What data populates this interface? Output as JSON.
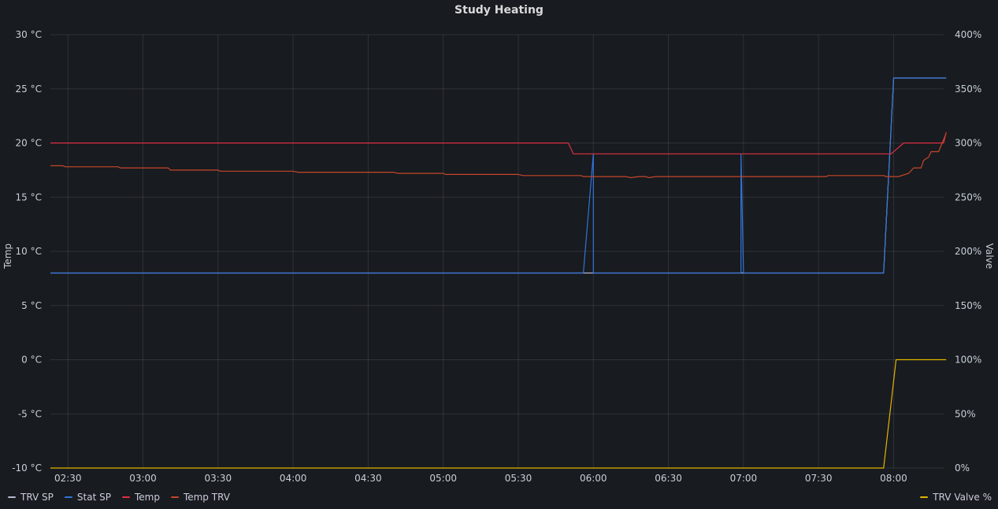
{
  "chart_data": {
    "type": "line",
    "title": "Study Heating",
    "y_left": {
      "label": "Temp",
      "ticks": [
        "30 °C",
        "25 °C",
        "20 °C",
        "15 °C",
        "10 °C",
        "5 °C",
        "0 °C",
        "-5 °C",
        "-10 °C"
      ],
      "min": -10,
      "max": 30,
      "step": 5
    },
    "y_right": {
      "label": "Valve",
      "ticks": [
        "400%",
        "350%",
        "300%",
        "250%",
        "200%",
        "150%",
        "100%",
        "50%",
        "0%"
      ],
      "min": 0,
      "max": 400,
      "step": 50
    },
    "x": {
      "ticks": [
        "02:30",
        "03:00",
        "03:30",
        "04:00",
        "04:30",
        "05:00",
        "05:30",
        "06:00",
        "06:30",
        "07:00",
        "07:30",
        "08:00"
      ],
      "start_min": 143,
      "end_min": 500
    },
    "grid": true,
    "legend": {
      "left": [
        {
          "name": "TRV SP",
          "color": "#b7b9d0"
        },
        {
          "name": "Stat SP",
          "color": "#3274d9"
        },
        {
          "name": "Temp",
          "color": "#e02f44"
        },
        {
          "name": "Temp TRV",
          "color": "#c4472b"
        }
      ],
      "right": [
        {
          "name": "TRV Valve %",
          "color": "#e0b400"
        }
      ]
    },
    "series": [
      {
        "name": "TRV SP",
        "color": "#b7b9d0",
        "axis": "left",
        "points": [
          [
            "02:23",
            8
          ],
          [
            "07:56",
            8
          ],
          [
            "08:00",
            26
          ],
          [
            "08:21",
            26
          ]
        ]
      },
      {
        "name": "Stat SP",
        "color": "#3274d9",
        "axis": "left",
        "points": [
          [
            "02:23",
            8
          ],
          [
            "05:56",
            8
          ],
          [
            "06:00",
            19
          ],
          [
            "06:00",
            8
          ],
          [
            "06:59",
            8
          ],
          [
            "06:59",
            19
          ],
          [
            "07:00",
            8
          ],
          [
            "07:56",
            8
          ],
          [
            "08:00",
            26
          ],
          [
            "08:21",
            26
          ]
        ]
      },
      {
        "name": "Temp",
        "color": "#e02f44",
        "axis": "left",
        "points": [
          [
            "02:23",
            20
          ],
          [
            "05:50",
            20
          ],
          [
            "05:52",
            19
          ],
          [
            "07:59",
            19
          ],
          [
            "08:04",
            20
          ],
          [
            "08:20",
            20
          ],
          [
            "08:21",
            21
          ]
        ]
      },
      {
        "name": "Temp TRV",
        "color": "#c4472b",
        "axis": "left",
        "points": [
          [
            "02:23",
            17.9
          ],
          [
            "02:28",
            17.9
          ],
          [
            "02:29",
            17.8
          ],
          [
            "02:50",
            17.8
          ],
          [
            "02:51",
            17.7
          ],
          [
            "03:10",
            17.7
          ],
          [
            "03:11",
            17.5
          ],
          [
            "03:30",
            17.5
          ],
          [
            "03:31",
            17.4
          ],
          [
            "04:00",
            17.4
          ],
          [
            "04:02",
            17.3
          ],
          [
            "04:40",
            17.3
          ],
          [
            "04:42",
            17.2
          ],
          [
            "05:00",
            17.2
          ],
          [
            "05:01",
            17.1
          ],
          [
            "05:30",
            17.1
          ],
          [
            "05:32",
            17.0
          ],
          [
            "05:55",
            17.0
          ],
          [
            "05:56",
            16.9
          ],
          [
            "06:13",
            16.9
          ],
          [
            "06:15",
            16.8
          ],
          [
            "06:18",
            16.9
          ],
          [
            "06:21",
            16.9
          ],
          [
            "06:22",
            16.8
          ],
          [
            "06:25",
            16.9
          ],
          [
            "07:33",
            16.9
          ],
          [
            "07:34",
            17.0
          ],
          [
            "07:56",
            17.0
          ],
          [
            "07:57",
            16.9
          ],
          [
            "08:02",
            16.9
          ],
          [
            "08:06",
            17.2
          ],
          [
            "08:08",
            17.7
          ],
          [
            "08:11",
            17.7
          ],
          [
            "08:12",
            18.4
          ],
          [
            "08:14",
            18.7
          ],
          [
            "08:15",
            19.2
          ],
          [
            "08:18",
            19.2
          ],
          [
            "08:21",
            20.9
          ]
        ]
      },
      {
        "name": "TRV Valve %",
        "color": "#e0b400",
        "axis": "right",
        "points": [
          [
            "02:23",
            0
          ],
          [
            "07:56",
            0
          ],
          [
            "08:01",
            100
          ],
          [
            "08:21",
            100
          ]
        ]
      }
    ]
  }
}
